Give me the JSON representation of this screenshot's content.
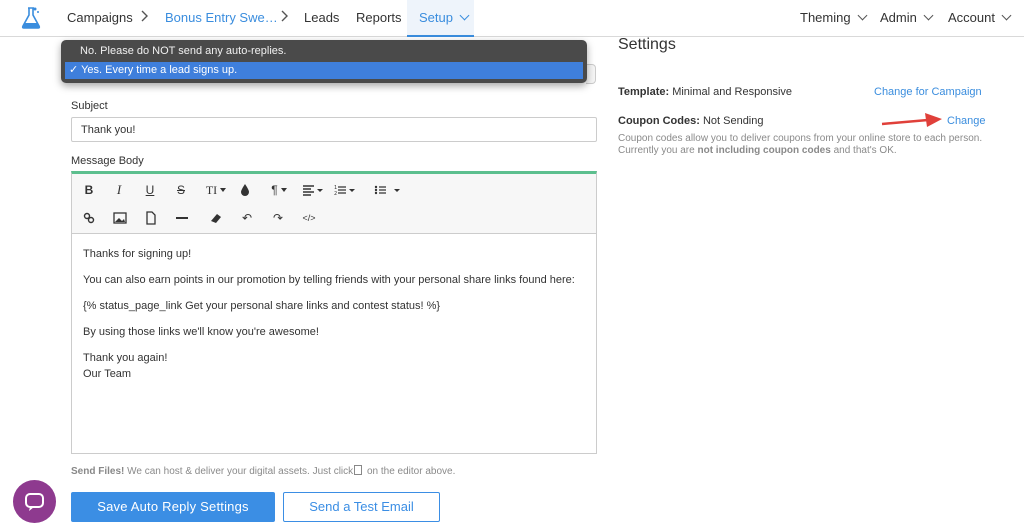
{
  "nav": {
    "items": [
      "Campaigns",
      "Bonus Entry Swe…",
      "Leads",
      "Reports",
      "Setup"
    ],
    "right": [
      "Theming",
      "Admin",
      "Account"
    ]
  },
  "autoreply": {
    "options": [
      "No. Please do NOT send any auto-replies.",
      "Yes. Every time a lead signs up."
    ],
    "selected_index": 1,
    "check_mark": "✓"
  },
  "form": {
    "subject_label": "Subject",
    "subject_value": "Thank you!",
    "body_label": "Message Body",
    "body_lines": [
      "Thanks for signing up!",
      "You can also earn points in our promotion by telling friends with your personal share links found here:",
      "{% status_page_link Get your personal share links and contest status! %}",
      "By using those links we'll know you're awesome!"
    ],
    "sign_off": [
      "Thank you again!",
      "Our Team"
    ],
    "send_files_bold": "Send Files!",
    "send_files_text": " We can host & deliver your digital assets. Just click",
    "send_files_tail": " on the editor above.",
    "save_label": "Save Auto Reply Settings",
    "test_label": "Send a Test Email"
  },
  "toolbar": {
    "bold": "B",
    "italic": "I",
    "underline": "U",
    "strike": "S",
    "text_size": "TI",
    "color": "●",
    "paragraph": "¶",
    "align": "≡",
    "ol": "☰",
    "ul": "☰",
    "undo": "↶",
    "redo": "↷",
    "code": "</>"
  },
  "settings": {
    "title": "Settings",
    "template_label": "Template:",
    "template_value": " Minimal and Responsive",
    "template_link": "Change for Campaign",
    "coupon_label": "Coupon Codes:",
    "coupon_value": " Not Sending",
    "coupon_link": "Change",
    "coupon_desc_1": "Coupon codes allow you to deliver coupons from your online store to each person. Currently you are ",
    "coupon_desc_bold": "not including coupon codes",
    "coupon_desc_2": " and that's OK."
  },
  "colors": {
    "accent": "#3a8dde",
    "editor_top": "#5cbf8e",
    "chat": "#8e3a8f",
    "annotation_arrow": "#e0403a"
  }
}
